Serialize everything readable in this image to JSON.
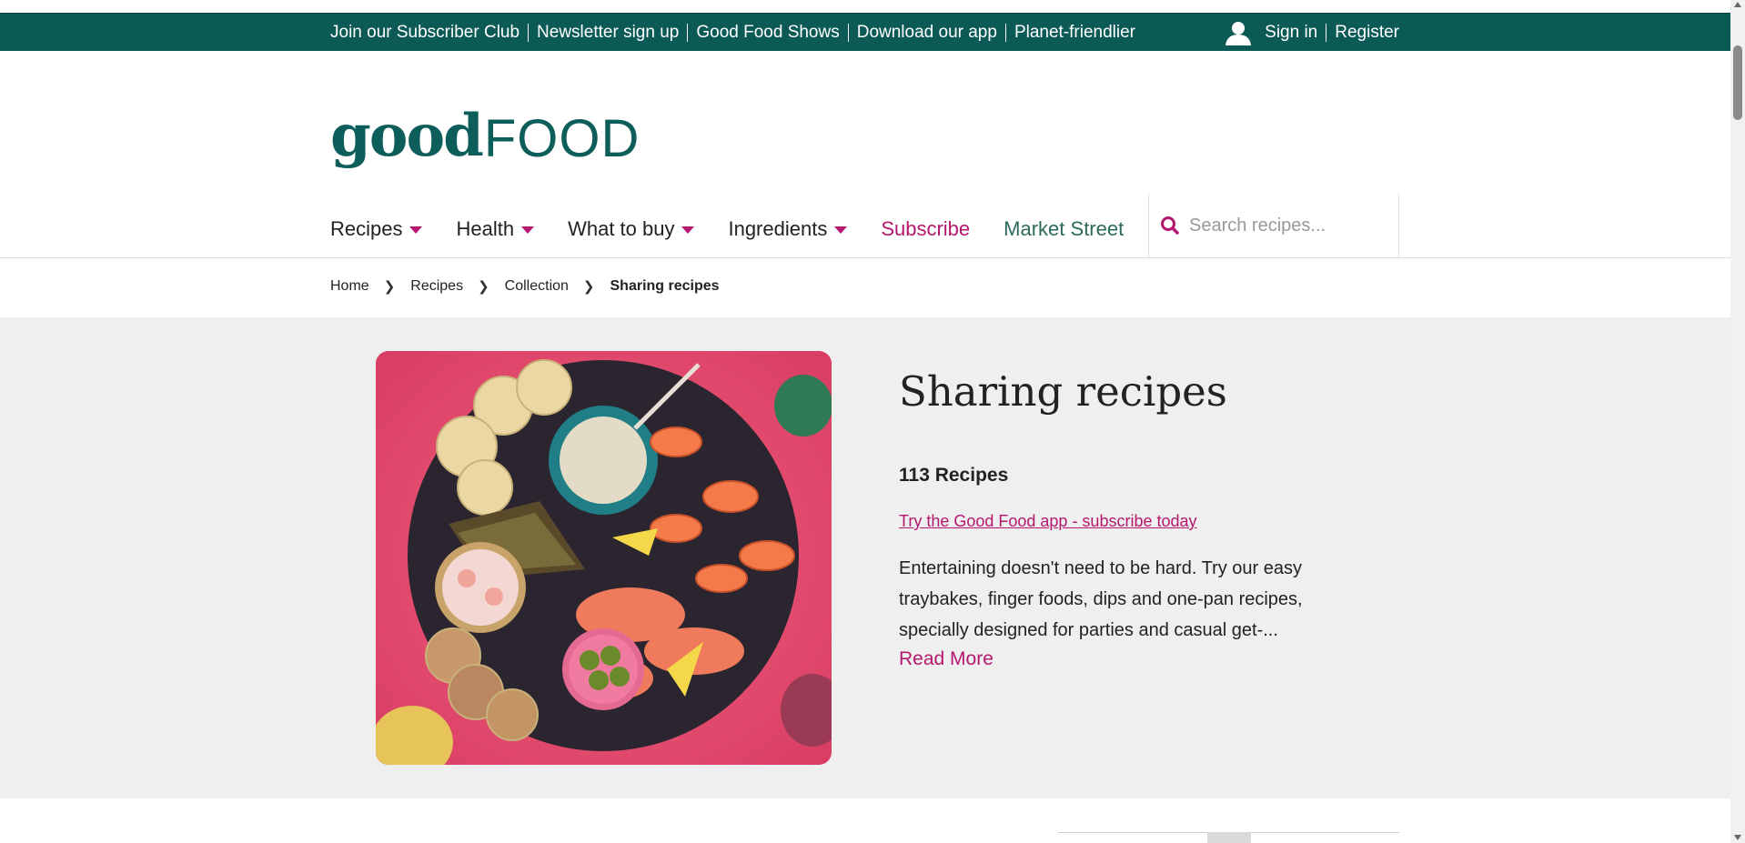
{
  "topbar": {
    "links": [
      "Join our Subscriber Club",
      "Newsletter sign up",
      "Good Food Shows",
      "Download our app",
      "Planet-friendlier"
    ],
    "sign_in": "Sign in",
    "register": "Register",
    "background": "#0b5a56"
  },
  "logo": {
    "good": "good",
    "food": "FOOD",
    "color": "#0d5e5a"
  },
  "nav": {
    "recipes": "Recipes",
    "health": "Health",
    "what_to_buy": "What to buy",
    "ingredients": "Ingredients",
    "subscribe": "Subscribe",
    "market_street": "Market Street",
    "accent": "#b5176e"
  },
  "search": {
    "placeholder": "Search recipes..."
  },
  "breadcrumb": {
    "home": "Home",
    "recipes": "Recipes",
    "collection": "Collection",
    "current": "Sharing recipes"
  },
  "hero": {
    "title": "Sharing recipes",
    "count": "113 Recipes",
    "app_link": "Try the Good Food app - subscribe today",
    "description": "Entertaining doesn't need to be hard. Try our easy traybakes, finger foods, dips and one-pan recipes, specially designed for parties and casual get-...",
    "read_more": "Read More",
    "image_icon": "seafood-sharing-platter-image"
  }
}
